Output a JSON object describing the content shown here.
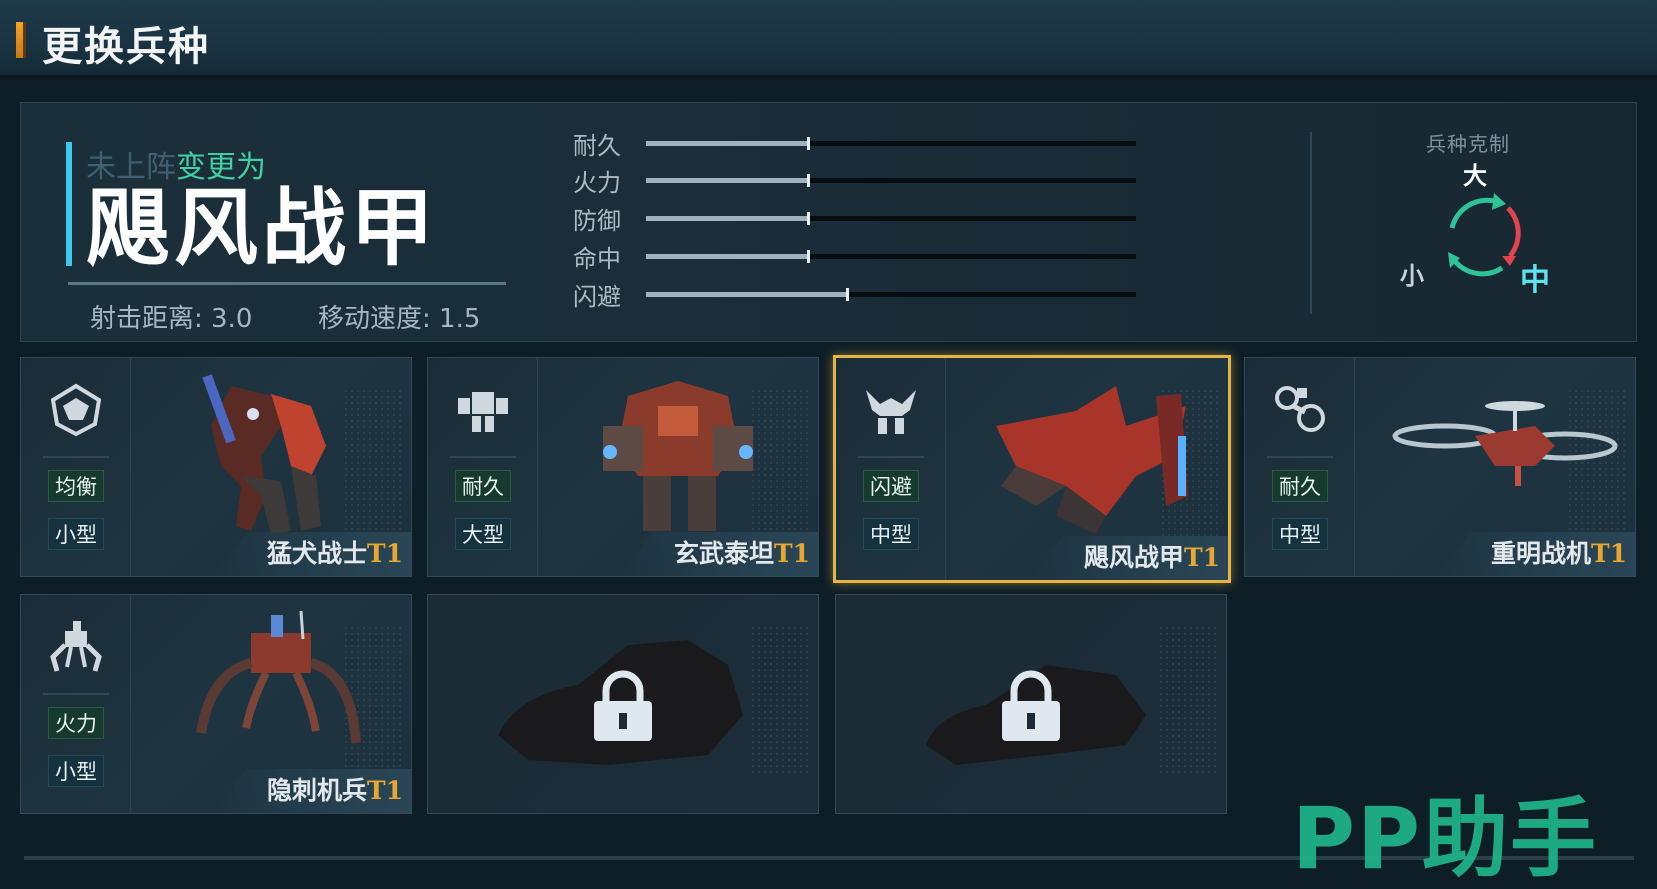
{
  "header": {
    "title": "更换兵种"
  },
  "info": {
    "status_prefix": "未上阵",
    "status_change": "变更为",
    "unit_name": "飓风战甲",
    "range": "射击距离: 3.0",
    "speed": "移动速度: 1.5"
  },
  "attributes": [
    {
      "label": "耐久",
      "level": 0.33
    },
    {
      "label": "火力",
      "level": 0.33
    },
    {
      "label": "防御",
      "level": 0.33
    },
    {
      "label": "命中",
      "level": 0.33
    },
    {
      "label": "闪避",
      "level": 0.41
    }
  ],
  "counter": {
    "title": "兵种克制",
    "large": "大",
    "medium": "中",
    "small": "小",
    "colors": {
      "large_to_medium": "#e0444e",
      "medium_to_small": "#2fc39a",
      "small_to_large": "#2fc39a",
      "medium": "#5fe3f0"
    }
  },
  "units": [
    {
      "name": "猛犬战士",
      "tier": "T1",
      "type": "均衡",
      "size": "小型",
      "icon": "balanced-mech-icon",
      "selected": false
    },
    {
      "name": "玄武泰坦",
      "tier": "T1",
      "type": "耐久",
      "size": "大型",
      "icon": "titan-mech-icon",
      "selected": false
    },
    {
      "name": "飓风战甲",
      "tier": "T1",
      "type": "闪避",
      "size": "中型",
      "icon": "agile-mech-icon",
      "selected": true
    },
    {
      "name": "重明战机",
      "tier": "T1",
      "type": "耐久",
      "size": "中型",
      "icon": "aircraft-icon",
      "selected": false
    },
    {
      "name": "隐刺机兵",
      "tier": "T1",
      "type": "火力",
      "size": "小型",
      "icon": "spider-mech-icon",
      "selected": false
    }
  ],
  "locked_slots": [
    {
      "icon": "lock-icon"
    },
    {
      "icon": "lock-icon"
    }
  ],
  "watermark": "PP助手",
  "colors": {
    "accent_gold": "#e5b443",
    "accent_cyan": "#3fc6e8",
    "accent_green": "#3fd0a4",
    "tier_orange": "#e6a833"
  }
}
